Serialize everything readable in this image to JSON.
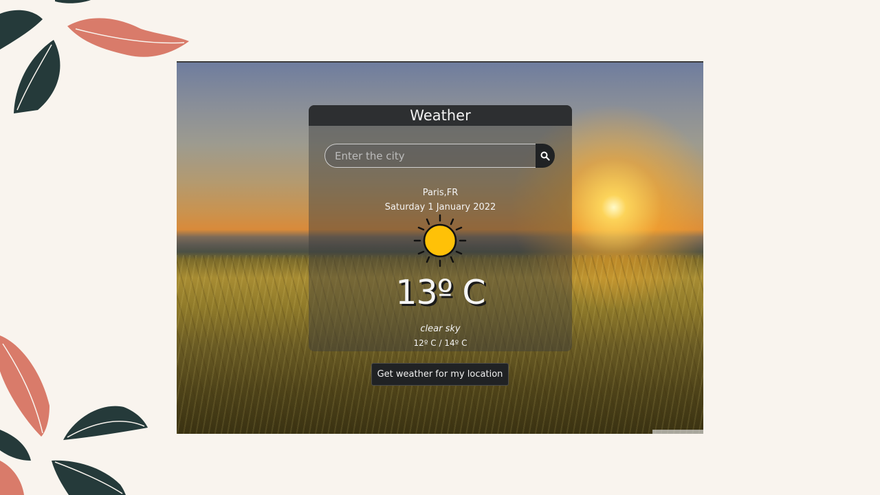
{
  "app": {
    "title": "Weather"
  },
  "search": {
    "placeholder": "Enter the city",
    "value": "",
    "button_icon": "search-icon"
  },
  "weather": {
    "location": "Paris,FR",
    "date": "Saturday 1 January 2022",
    "icon": "sun-icon",
    "temperature": "13º C",
    "description": "clear sky",
    "range": "12º C / 14º C"
  },
  "actions": {
    "location_button_label": "Get weather for my location"
  },
  "colors": {
    "page_background": "#f9f4ee",
    "card_header": "#2d2f31",
    "sun": "#ffc107",
    "leaf_dark": "#253a3a",
    "leaf_coral": "#d97b6a"
  }
}
